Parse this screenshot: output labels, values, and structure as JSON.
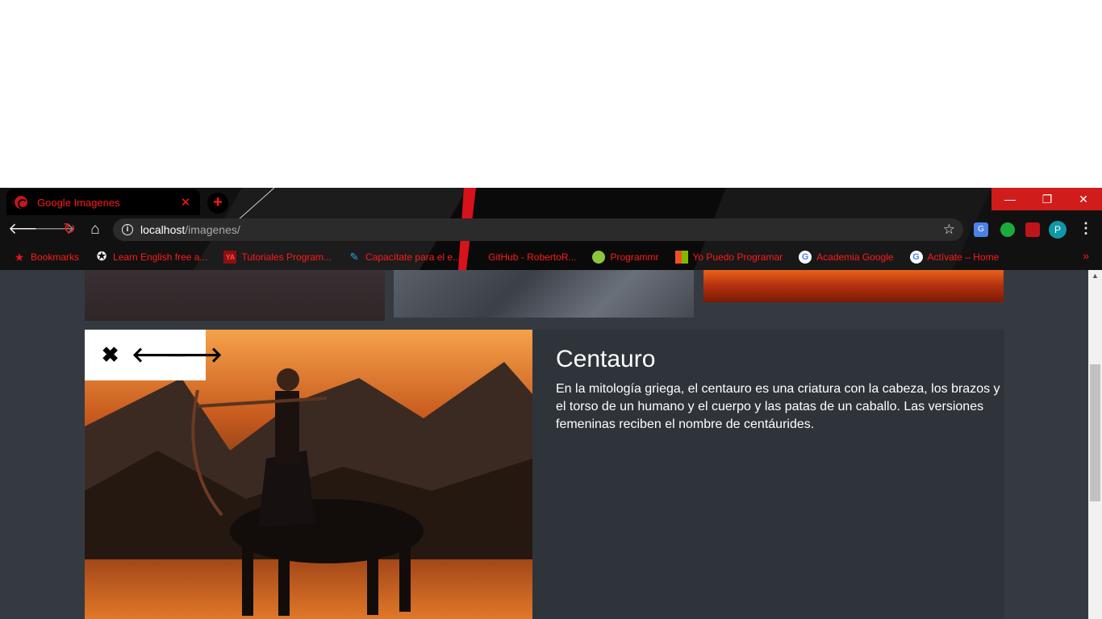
{
  "browser": {
    "tab_title": "Google Imagenes",
    "tab_close": "✕",
    "new_tab": "+",
    "window_controls": {
      "minimize": "—",
      "maximize": "❐",
      "close": "✕"
    },
    "url_host": "localhost",
    "url_path": "/imagenes/",
    "profile_initial": "P"
  },
  "bookmarks": [
    {
      "label": "Bookmarks",
      "icon": "star-icon"
    },
    {
      "label": "Learn English free a...",
      "icon": "star-badge-icon"
    },
    {
      "label": "Tutoriales Program...",
      "icon": "ya-icon"
    },
    {
      "label": "Capacítate para el e...",
      "icon": "edit-icon"
    },
    {
      "label": "GitHub - RobertoR...",
      "icon": "github-icon"
    },
    {
      "label": "Programmr",
      "icon": "programmr-icon"
    },
    {
      "label": "Yo Puedo Programar",
      "icon": "microsoft-icon"
    },
    {
      "label": "Academia Google",
      "icon": "google-icon"
    },
    {
      "label": "Actívate – Home",
      "icon": "google-icon"
    }
  ],
  "bookmarks_more": "»",
  "detail": {
    "title": "Centauro",
    "description": "En la mitología griega, el centauro es una criatura con la cabeza, los brazos y el torso de un humano y el cuerpo y las patas de un caballo. Las versiones femeninas reciben el nombre de centáurides.",
    "controls": {
      "close": "✖",
      "prev": "🡐",
      "next": "🡒"
    }
  },
  "colors": {
    "accent": "#ff1a1a",
    "page_bg": "#353a41",
    "panel_bg": "#2f343b"
  }
}
